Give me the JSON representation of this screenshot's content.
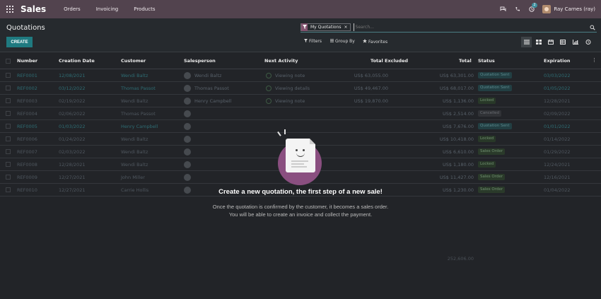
{
  "app": {
    "title": "Sales",
    "menus": [
      "Orders",
      "Invoicing",
      "Products"
    ],
    "activity_count": "2",
    "user_name": "Ray Carnes (ray)"
  },
  "control": {
    "page_title": "Quotations",
    "create_label": "CREATE",
    "facet_label": "My Quotations",
    "facet_close": "×",
    "search_placeholder": "Search...",
    "filters_label": "Filters",
    "groupby_label": "Group By",
    "favorites_label": "Favorites"
  },
  "table": {
    "headers": {
      "number": "Number",
      "creation_date": "Creation Date",
      "customer": "Customer",
      "salesperson": "Salesperson",
      "next_activity": "Next Activity",
      "total_excluded": "Total Excluded",
      "total": "Total",
      "status": "Status",
      "expiration": "Expiration"
    },
    "rows": [
      {
        "number": "REF0001",
        "date": "12/08/2021",
        "customer": "Wendi Baltz",
        "salesperson": "Wendi Baltz",
        "activity": "Viewing note",
        "excluded": "US$ 63,055.00",
        "total": "US$ 63,301.00",
        "status": "Quotation Sent",
        "expiration": "03/03/2022"
      },
      {
        "number": "REF0002",
        "date": "03/12/2022",
        "customer": "Thomas Passot",
        "salesperson": "Thomas Passot",
        "activity": "Viewing details",
        "excluded": "US$ 49,467.00",
        "total": "US$ 68,017.00",
        "status": "Quotation Sent",
        "expiration": "01/05/2022"
      },
      {
        "number": "REF0003",
        "date": "02/19/2022",
        "customer": "Wendi Baltz",
        "salesperson": "Henry Campbell",
        "activity": "Viewing note",
        "excluded": "US$ 19,870.00",
        "total": "US$ 1,136.00",
        "status": "Locked",
        "expiration": "12/28/2021"
      },
      {
        "number": "REF0004",
        "date": "02/06/2022",
        "customer": "Thomas Passot",
        "salesperson": "",
        "activity": "",
        "excluded": "",
        "total": "US$ 2,514.00",
        "status": "Cancelled",
        "expiration": "02/09/2022"
      },
      {
        "number": "REF0005",
        "date": "01/03/2022",
        "customer": "Henry Campbell",
        "salesperson": "",
        "activity": "",
        "excluded": "",
        "total": "US$ 7,676.00",
        "status": "Quotation Sent",
        "expiration": "01/01/2022"
      },
      {
        "number": "REF0006",
        "date": "01/24/2022",
        "customer": "Wendi Baltz",
        "salesperson": "",
        "activity": "",
        "excluded": "",
        "total": "US$ 10,418.00",
        "status": "Locked",
        "expiration": "01/14/2022"
      },
      {
        "number": "REF0007",
        "date": "02/03/2022",
        "customer": "Wendi Baltz",
        "salesperson": "",
        "activity": "",
        "excluded": "",
        "total": "US$ 6,610.00",
        "status": "Sales Order",
        "expiration": "01/29/2022"
      },
      {
        "number": "REF0008",
        "date": "12/28/2021",
        "customer": "Wendi Baltz",
        "salesperson": "",
        "activity": "",
        "excluded": "",
        "total": "US$ 1,180.00",
        "status": "Locked",
        "expiration": "12/24/2021"
      },
      {
        "number": "REF0009",
        "date": "12/27/2021",
        "customer": "John Miller",
        "salesperson": "",
        "activity": "",
        "excluded": "",
        "total": "US$ 11,427.00",
        "status": "Sales Order",
        "expiration": "12/16/2021"
      },
      {
        "number": "REF0010",
        "date": "12/27/2021",
        "customer": "Carrie Hollis",
        "salesperson": "",
        "activity": "",
        "excluded": "",
        "total": "US$ 1,230.00",
        "status": "Sales Order",
        "expiration": "01/04/2022"
      }
    ],
    "grand_total": "252,606.00"
  },
  "helper": {
    "title": "Create a new quotation, the first step of a new sale!",
    "line1": "Once the quotation is confirmed by the customer, it becomes a sales order.",
    "line2": "You will be able to create an invoice and collect the payment."
  },
  "colors": {
    "navbar": "#52434e",
    "accent": "#1f7a80",
    "status_sent_bg": "#23494d",
    "status_locked_bg": "#2f4a31",
    "status_cancelled_bg": "#3a3a3a"
  }
}
